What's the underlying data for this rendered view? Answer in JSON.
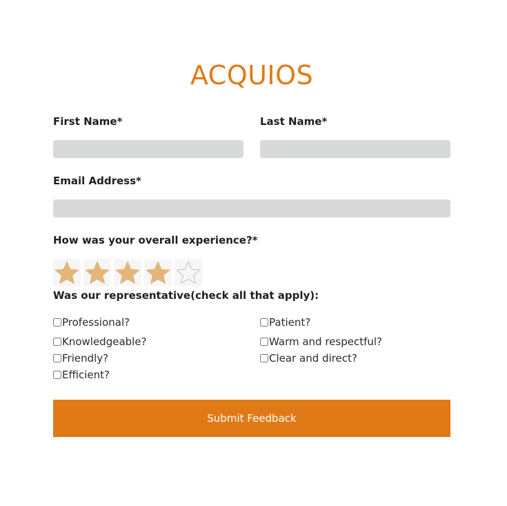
{
  "brand": {
    "title": "ACQUIOS"
  },
  "colors": {
    "accent": "#e07a16",
    "input_bg": "#d7d9da",
    "star_filled": "#e3b57a",
    "star_empty_stroke": "#c8c8c8"
  },
  "form": {
    "first_name": {
      "label": "First Name*",
      "value": "",
      "placeholder": ""
    },
    "last_name": {
      "label": "Last Name*",
      "value": "",
      "placeholder": ""
    },
    "email": {
      "label": "Email Address*",
      "value": "",
      "placeholder": ""
    },
    "rating": {
      "label": "How was your overall experience?*",
      "value": 4,
      "max": 5
    },
    "representative": {
      "label": "Was our representative(check all that apply):",
      "options": [
        {
          "label": "Professional?",
          "checked": false
        },
        {
          "label": "Patient?",
          "checked": false
        },
        {
          "label": "Knowledgeable?",
          "checked": false
        },
        {
          "label": "Warm and respectful?",
          "checked": false
        },
        {
          "label": "Friendly?",
          "checked": false
        },
        {
          "label": "Clear and direct?",
          "checked": false
        },
        {
          "label": "Efficient?",
          "checked": false
        }
      ]
    },
    "submit_label": "Submit Feedback"
  }
}
